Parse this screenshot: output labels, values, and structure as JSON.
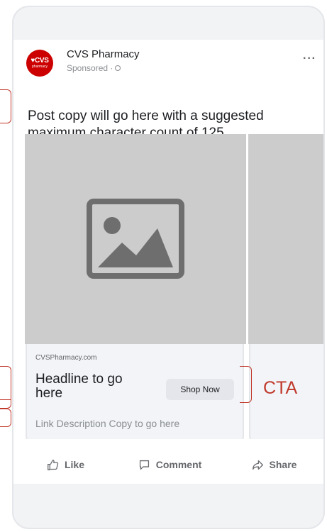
{
  "post": {
    "page_name": "CVS Pharmacy",
    "sponsored": "Sponsored ·",
    "avatar_brand": "♥CVS",
    "avatar_sub": "pharmacy",
    "more_label": "···",
    "copy": "Post copy will go here with a suggested maximum character count of 125."
  },
  "carousel": {
    "cards": [
      {
        "domain": "CVSPharmacy.com",
        "headline": "Headline to go here",
        "cta": "Shop Now",
        "description": "Link Description Copy to go here"
      }
    ]
  },
  "actions": {
    "like": "Like",
    "comment": "Comment",
    "share": "Share"
  },
  "annotations": {
    "cta_label": "CTA",
    "color": "#c0392b"
  },
  "colors": {
    "brand": "#cc0000",
    "placeholder": "#cccccc",
    "icon": "#6e6e6e"
  }
}
